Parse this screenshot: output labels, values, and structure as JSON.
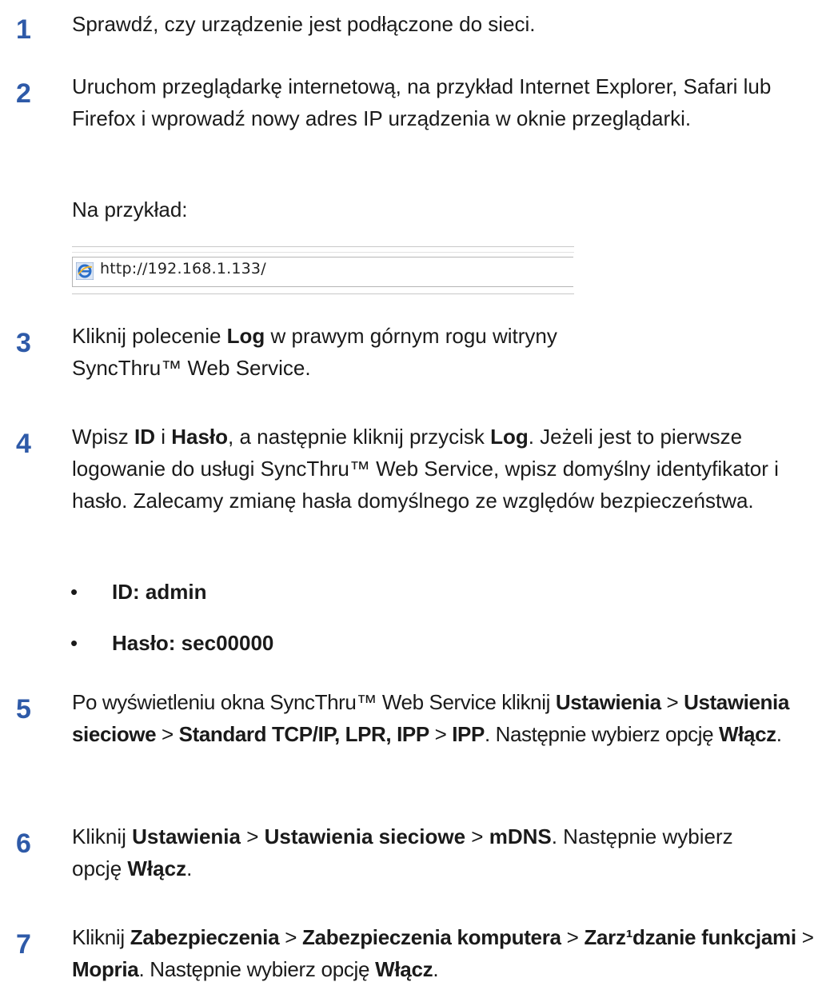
{
  "steps": [
    {
      "num": "1",
      "parts": [
        {
          "t": "Sprawdź, czy urządzenie jest podłączone do sieci."
        }
      ]
    },
    {
      "num": "2",
      "parts": [
        {
          "t": "Uruchom przeglądarkę internetową, na przykład Internet Explorer, Safari lub Firefox i wprowadź nowy adres IP urządzenia w oknie przeglądarki."
        }
      ]
    },
    {
      "num": "3",
      "parts": [
        {
          "t": "Kliknij polecenie "
        },
        {
          "t": "Log",
          "b": true
        },
        {
          "t": " w prawym górnym rogu witryny SyncThru™ Web Service."
        }
      ]
    },
    {
      "num": "4",
      "parts": [
        {
          "t": "Wpisz "
        },
        {
          "t": "ID",
          "b": true
        },
        {
          "t": " i "
        },
        {
          "t": "Hasło",
          "b": true
        },
        {
          "t": ", a następnie kliknij przycisk "
        },
        {
          "t": "Log",
          "b": true
        },
        {
          "t": ". Jeżeli jest to pierwsze logowanie do usługi SyncThru™ Web Service, wpisz domyślny identyfikator i hasło. Zalecamy zmianę hasła domyślnego ze względów bezpieczeństwa."
        }
      ]
    },
    {
      "num": "5",
      "parts": [
        {
          "t": "Po wyświetleniu okna SyncThru™ Web Service kliknij "
        },
        {
          "t": "Ustawienia",
          "b": true
        },
        {
          "t": " > "
        },
        {
          "t": "Ustawienia sieciowe",
          "b": true
        },
        {
          "t": " > "
        },
        {
          "t": "Standard TCP/IP, LPR, IPP",
          "b": true
        },
        {
          "t": " > "
        },
        {
          "t": "IPP",
          "b": true
        },
        {
          "t": ". Następnie wybierz opcję "
        },
        {
          "t": "Włącz",
          "b": true
        },
        {
          "t": "."
        }
      ]
    },
    {
      "num": "6",
      "parts": [
        {
          "t": "Kliknij "
        },
        {
          "t": "Ustawienia",
          "b": true
        },
        {
          "t": " > "
        },
        {
          "t": "Ustawienia sieciowe",
          "b": true
        },
        {
          "t": " > "
        },
        {
          "t": "mDNS",
          "b": true
        },
        {
          "t": ". Następnie wybierz opcję "
        },
        {
          "t": "Włącz",
          "b": true
        },
        {
          "t": "."
        }
      ]
    },
    {
      "num": "7",
      "parts": [
        {
          "t": "Kliknij "
        },
        {
          "t": "Zabezpieczenia",
          "b": true
        },
        {
          "t": " > "
        },
        {
          "t": "Zabezpieczenia komputera",
          "b": true
        },
        {
          "t": " > "
        },
        {
          "t": "Zarz¹dzanie funkcjami",
          "b": true
        },
        {
          "t": " > "
        },
        {
          "t": "Mopria",
          "b": true
        },
        {
          "t": ". Następnie wybierz opcję "
        },
        {
          "t": "Włącz",
          "b": true
        },
        {
          "t": "."
        }
      ]
    }
  ],
  "example_label": "Na przykład:",
  "url": "http://192.168.1.133/",
  "bullets": [
    "ID: admin",
    "Hasło: sec00000"
  ],
  "colors": {
    "step_number": "#2e5aa8",
    "text": "#1a1a1a"
  },
  "icons": {
    "browser": "internet-explorer-icon"
  }
}
